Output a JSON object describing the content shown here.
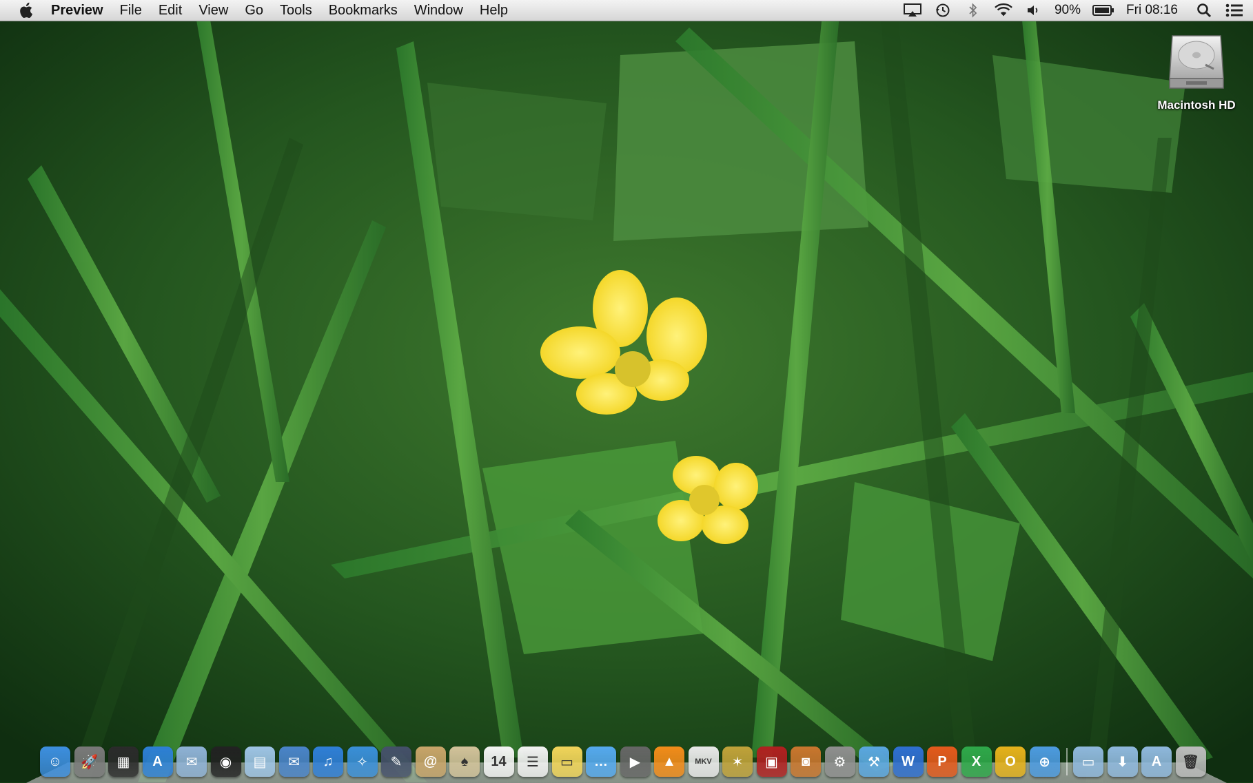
{
  "menubar": {
    "apple_icon": "apple-logo-icon",
    "app_name": "Preview",
    "menus": [
      "File",
      "Edit",
      "View",
      "Go",
      "Tools",
      "Bookmarks",
      "Window",
      "Help"
    ],
    "status": {
      "icons": [
        "airplay-icon",
        "time-machine-icon",
        "bluetooth-icon",
        "wifi-icon",
        "volume-icon"
      ],
      "battery_percent": "90%",
      "battery_icon": "battery-icon",
      "clock": "Fri 08:16",
      "spotlight_icon": "spotlight-search-icon",
      "notification_icon": "notification-center-icon"
    }
  },
  "desktop": {
    "wallpaper": "green-grass-yellow-buttercup-flowers",
    "icons": [
      {
        "label": "Macintosh HD",
        "icon": "hard-drive-icon"
      }
    ]
  },
  "dock": {
    "apps": [
      {
        "name": "finder",
        "color": "#3d8fe0",
        "glyph": "☺"
      },
      {
        "name": "launchpad",
        "color": "#7a7a7a",
        "glyph": "🚀"
      },
      {
        "name": "mission-control",
        "color": "#2b2b2b",
        "glyph": "▦"
      },
      {
        "name": "app-store",
        "color": "#2d7fd6",
        "glyph": "A"
      },
      {
        "name": "preview",
        "color": "#8fb2d6",
        "glyph": "✉"
      },
      {
        "name": "photo-booth",
        "color": "#222222",
        "glyph": "◉"
      },
      {
        "name": "iphoto",
        "color": "#9ec4e5",
        "glyph": "▤"
      },
      {
        "name": "mail",
        "color": "#4a84c9",
        "glyph": "✉"
      },
      {
        "name": "itunes",
        "color": "#2f7fd8",
        "glyph": "♫"
      },
      {
        "name": "safari",
        "color": "#3a8fd9",
        "glyph": "✧"
      },
      {
        "name": "migration",
        "color": "#45506a",
        "glyph": "✎"
      },
      {
        "name": "address-book",
        "color": "#c8a56a",
        "glyph": "@"
      },
      {
        "name": "solitaire",
        "color": "#d2c29a",
        "glyph": "♠"
      },
      {
        "name": "calendar",
        "color": "#f4f4f4",
        "glyph": "14"
      },
      {
        "name": "reminders",
        "color": "#f2f2f2",
        "glyph": "☰"
      },
      {
        "name": "stickies",
        "color": "#f1d45a",
        "glyph": "▭"
      },
      {
        "name": "messages",
        "color": "#55a9ee",
        "glyph": "…"
      },
      {
        "name": "facetime",
        "color": "#666666",
        "glyph": "▶"
      },
      {
        "name": "vlc",
        "color": "#f28c1a",
        "glyph": "▲"
      },
      {
        "name": "mkv-player",
        "color": "#e8e8e8",
        "glyph": "MKV"
      },
      {
        "name": "cocktail",
        "color": "#c0a23a",
        "glyph": "✶"
      },
      {
        "name": "photo-slideshow",
        "color": "#b02020",
        "glyph": "▣"
      },
      {
        "name": "image-capture",
        "color": "#c9762e",
        "glyph": "◙"
      },
      {
        "name": "system-preferences",
        "color": "#8f8f8f",
        "glyph": "⚙"
      },
      {
        "name": "xcode",
        "color": "#5aa6e0",
        "glyph": "⚒"
      },
      {
        "name": "word",
        "color": "#2f6fd1",
        "glyph": "W"
      },
      {
        "name": "powerpoint",
        "color": "#e45a1c",
        "glyph": "P"
      },
      {
        "name": "excel",
        "color": "#2fa84a",
        "glyph": "X"
      },
      {
        "name": "outlook",
        "color": "#e6b21c",
        "glyph": "O"
      },
      {
        "name": "network-utility",
        "color": "#4d9be0",
        "glyph": "⊕"
      }
    ],
    "folders": [
      {
        "name": "documents-stack",
        "color": "#8fb8dd",
        "glyph": "▭"
      },
      {
        "name": "downloads-stack",
        "color": "#8fb8dd",
        "glyph": "⬇"
      },
      {
        "name": "applications-stack",
        "color": "#8fb8dd",
        "glyph": "A"
      }
    ],
    "trash": {
      "name": "trash",
      "color": "#bcbcbc",
      "glyph": "🗑"
    }
  }
}
